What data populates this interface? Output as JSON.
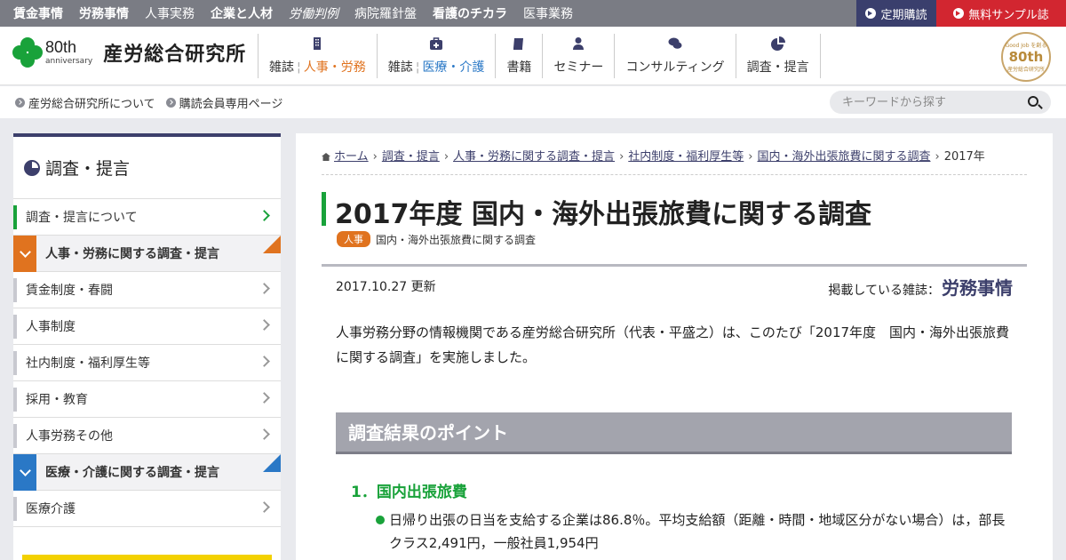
{
  "topbar": {
    "magazines": [
      {
        "label": "賃金事情",
        "style": "bold"
      },
      {
        "label": "労務事情",
        "style": "bold"
      },
      {
        "label": "人事実務",
        "style": "normal"
      },
      {
        "label": "企業と人材",
        "style": "bold"
      },
      {
        "label": "労働判例",
        "style": "italic"
      },
      {
        "label": "病院羅針盤",
        "style": "normal"
      },
      {
        "label": "看護のチカラ",
        "style": "bold"
      },
      {
        "label": "医事業務",
        "style": "normal"
      }
    ],
    "subscribe_label": "定期購読",
    "sample_label": "無料サンプル誌"
  },
  "header": {
    "anniversary_big": "80th",
    "anniversary_small": "anniversary",
    "org_name": "産労総合研究所",
    "nav": [
      {
        "icon": "building-icon",
        "part1": "雑誌",
        "part2": "人事・労務",
        "accent": "orange"
      },
      {
        "icon": "medical-bag-icon",
        "part1": "雑誌",
        "part2": "医療・介護",
        "accent": "blue"
      },
      {
        "icon": "book-icon",
        "part1": "書籍",
        "part2": "",
        "accent": ""
      },
      {
        "icon": "person-icon",
        "part1": "セミナー",
        "part2": "",
        "accent": ""
      },
      {
        "icon": "chat-icon",
        "part1": "コンサルティング",
        "part2": "",
        "accent": ""
      },
      {
        "icon": "pie-chart-icon",
        "part1": "調査・提言",
        "part2": "",
        "accent": ""
      }
    ],
    "seal_top": "Good Job を創る",
    "seal_main": "80th",
    "seal_bottom": "産労総合研究所"
  },
  "subnav": {
    "links": [
      "産労総合研究所について",
      "購読会員専用ページ"
    ],
    "search_placeholder": "キーワードから探す"
  },
  "sidebar": {
    "heading": "調査・提言",
    "items": [
      {
        "label": "調査・提言について",
        "type": "green"
      },
      {
        "label": "人事・労務に関する調査・提言",
        "type": "cat-orange"
      },
      {
        "label": "賃金制度・春闘",
        "type": "normal"
      },
      {
        "label": "人事制度",
        "type": "normal"
      },
      {
        "label": "社内制度・福利厚生等",
        "type": "normal"
      },
      {
        "label": "採用・教育",
        "type": "normal"
      },
      {
        "label": "人事労務その他",
        "type": "normal"
      },
      {
        "label": "医療・介護に関する調査・提言",
        "type": "cat-blue"
      },
      {
        "label": "医療介護",
        "type": "normal"
      }
    ]
  },
  "main": {
    "breadcrumbs": [
      "ホーム",
      "調査・提言",
      "人事・労務に関する調査・提言",
      "社内制度・福利厚生等",
      "国内・海外出張旅費に関する調査"
    ],
    "breadcrumb_current": "2017年",
    "title": "2017年度 国内・海外出張旅費に関する調査",
    "tag": "人事",
    "tag_text": "国内・海外出張旅費に関する調査",
    "date": "2017.10.27 更新",
    "published_label": "掲載している雑誌：",
    "published_magazine": "労務事情",
    "lead": "人事労務分野の情報機関である産労総合研究所（代表・平盛之）は、このたび「2017年度　国内・海外出張旅費に関する調査」を実施しました。",
    "section_title": "調査結果のポイント",
    "point_heading": "1．国内出張旅費",
    "bullet": "日帰り出張の日当を支給する企業は86.8％。平均支給額（距離・時間・地域区分がない場合）は，部長クラス2,491円，一般社員1,954円"
  }
}
